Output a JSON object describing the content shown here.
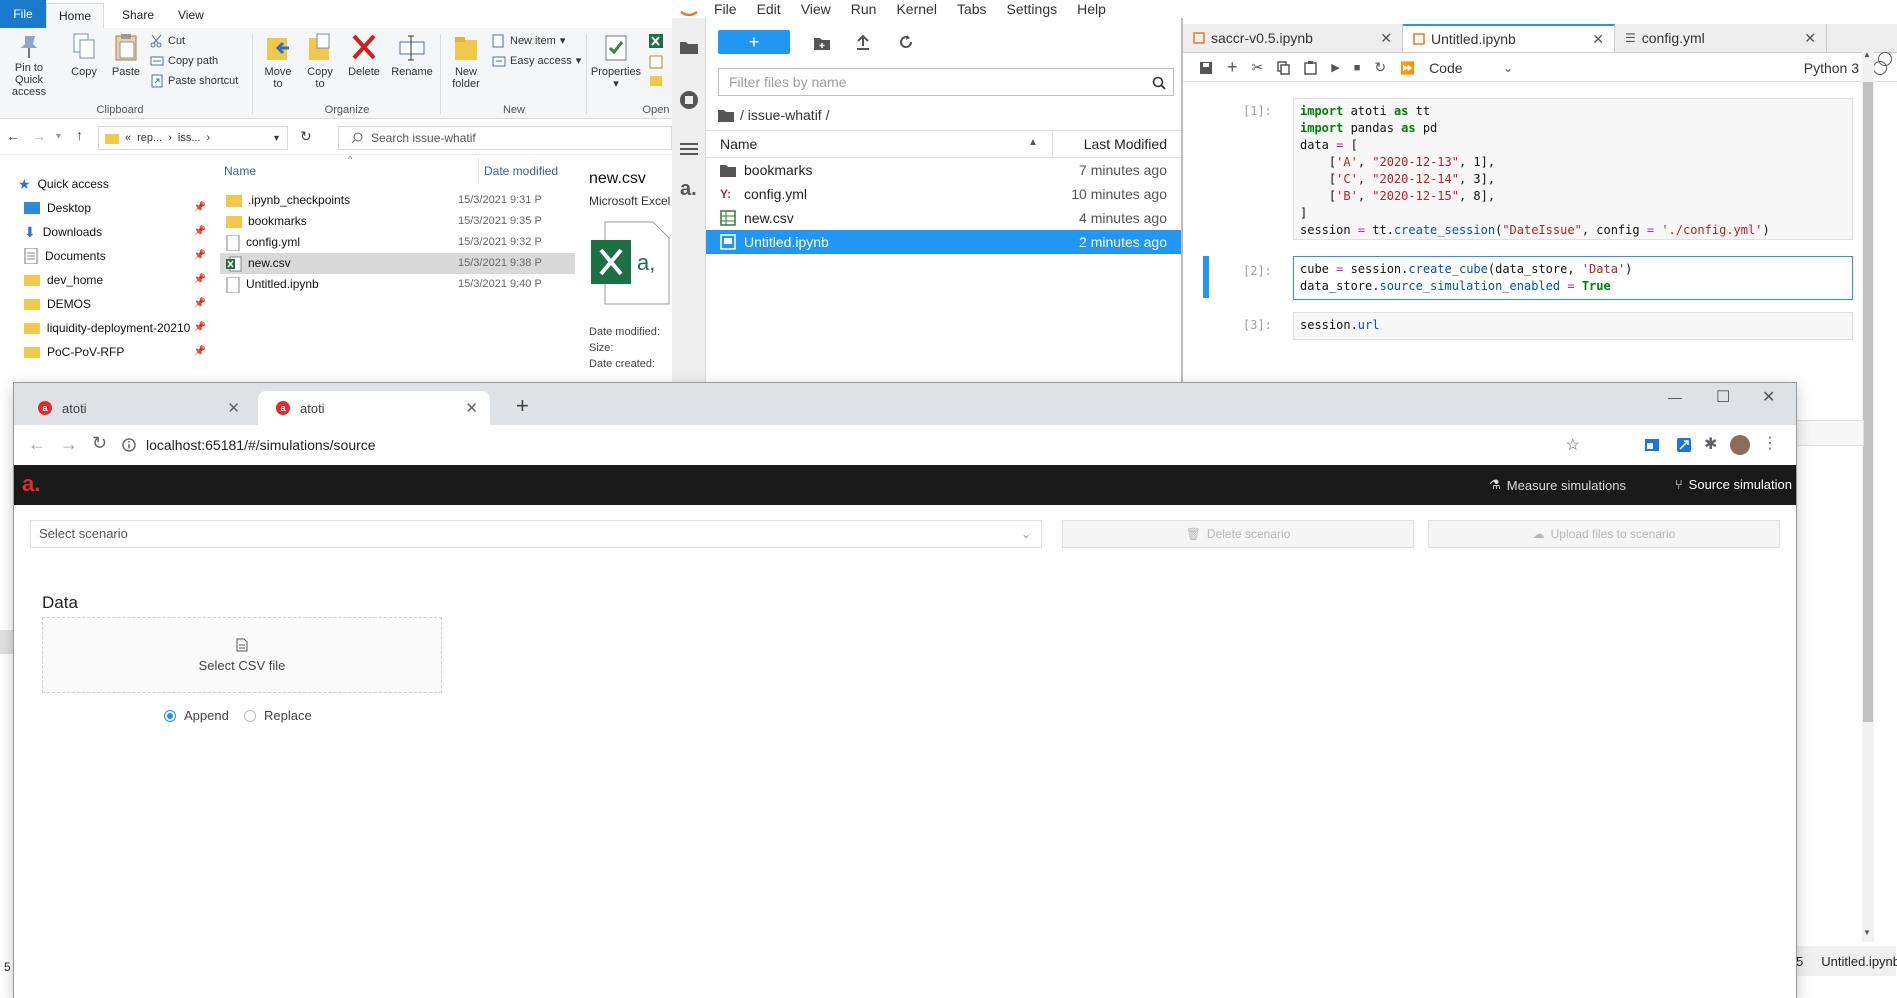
{
  "explorer": {
    "ribbon_tabs": [
      "File",
      "Home",
      "Share",
      "View"
    ],
    "clipboard": {
      "pin_label": "Pin to Quick access",
      "copy_label": "Copy",
      "paste_label": "Paste",
      "cut_label": "Cut",
      "copy_path_label": "Copy path",
      "paste_shortcut_label": "Paste shortcut",
      "group_label": "Clipboard"
    },
    "organize": {
      "move_label": "Move to",
      "copy_label": "Copy to",
      "delete_label": "Delete",
      "rename_label": "Rename",
      "group_label": "Organize"
    },
    "new_group": {
      "new_folder_label": "New folder",
      "new_item_label": "New item",
      "easy_access_label": "Easy access",
      "group_label": "New"
    },
    "open_group": {
      "properties_label": "Properties",
      "group_label": "Open"
    },
    "address": {
      "path_prefix": "«",
      "part1": "rep...",
      "part2": "iss..."
    },
    "search_placeholder": "Search issue-whatif",
    "nav": {
      "quick_access": "Quick access",
      "items": [
        "Desktop",
        "Downloads",
        "Documents",
        "dev_home",
        "DEMOS",
        "liquidity-deployment-20210",
        "PoC-PoV-RFP"
      ]
    },
    "columns": {
      "name": "Name",
      "date": "Date modified"
    },
    "files": [
      {
        "name": ".ipynb_checkpoints",
        "date": "15/3/2021 9:31 P"
      },
      {
        "name": "bookmarks",
        "date": "15/3/2021 9:35 P"
      },
      {
        "name": "config.yml",
        "date": "15/3/2021 9:32 P"
      },
      {
        "name": "new.csv",
        "date": "15/3/2021 9:38 P"
      },
      {
        "name": "Untitled.ipynb",
        "date": "15/3/2021 9:40 P"
      }
    ],
    "preview": {
      "title": "new.csv",
      "type": "Microsoft Excel",
      "date_modified": "Date modified:",
      "size": "Size:",
      "date_created": "Date created:"
    },
    "status_left": "5 i"
  },
  "jupyter": {
    "menu": [
      "File",
      "Edit",
      "View",
      "Run",
      "Kernel",
      "Tabs",
      "Settings",
      "Help"
    ],
    "new_button": "+",
    "filter_placeholder": "Filter files by name",
    "breadcrumb": "/ issue-whatif /",
    "list_header": {
      "name": "Name",
      "modified": "Last Modified"
    },
    "files": [
      {
        "name": "bookmarks",
        "modified": "7 minutes ago",
        "icon": "folder"
      },
      {
        "name": "config.yml",
        "modified": "10 minutes ago",
        "icon": "yaml"
      },
      {
        "name": "new.csv",
        "modified": "4 minutes ago",
        "icon": "spreadsheet"
      },
      {
        "name": "Untitled.ipynb",
        "modified": "2 minutes ago",
        "icon": "notebook"
      }
    ],
    "doc_tabs": [
      "saccr-v0.5.ipynb",
      "Untitled.ipynb",
      "config.yml"
    ],
    "cell_type": "Code",
    "kernel": "Python 3",
    "cells": [
      {
        "prompt": "[1]:"
      },
      {
        "prompt": "[2]:"
      },
      {
        "prompt": "[3]:"
      }
    ],
    "status_right": "Untitled.ipynb",
    "status_digit": "5"
  },
  "chrome": {
    "tabs": [
      {
        "title": "atoti"
      },
      {
        "title": "atoti"
      }
    ],
    "new_tab": "+",
    "url": "localhost:65181/#/simulations/source"
  },
  "atoti": {
    "logo": "a.",
    "nav": {
      "measure_simulations": "Measure simulations",
      "source_simulation": "Source simulation"
    },
    "select_scenario_placeholder": "Select scenario",
    "delete_scenario": "Delete scenario",
    "upload_files": "Upload files to scenario",
    "data_title": "Data",
    "select_csv": "Select CSV file",
    "append": "Append",
    "replace": "Replace",
    "mode": "append"
  },
  "colors": {
    "accent_blue": "#2196f3",
    "explorer_file_tab": "#1979ca",
    "atoti_red": "#e02c2c",
    "atoti_header": "#1a1a1a"
  }
}
